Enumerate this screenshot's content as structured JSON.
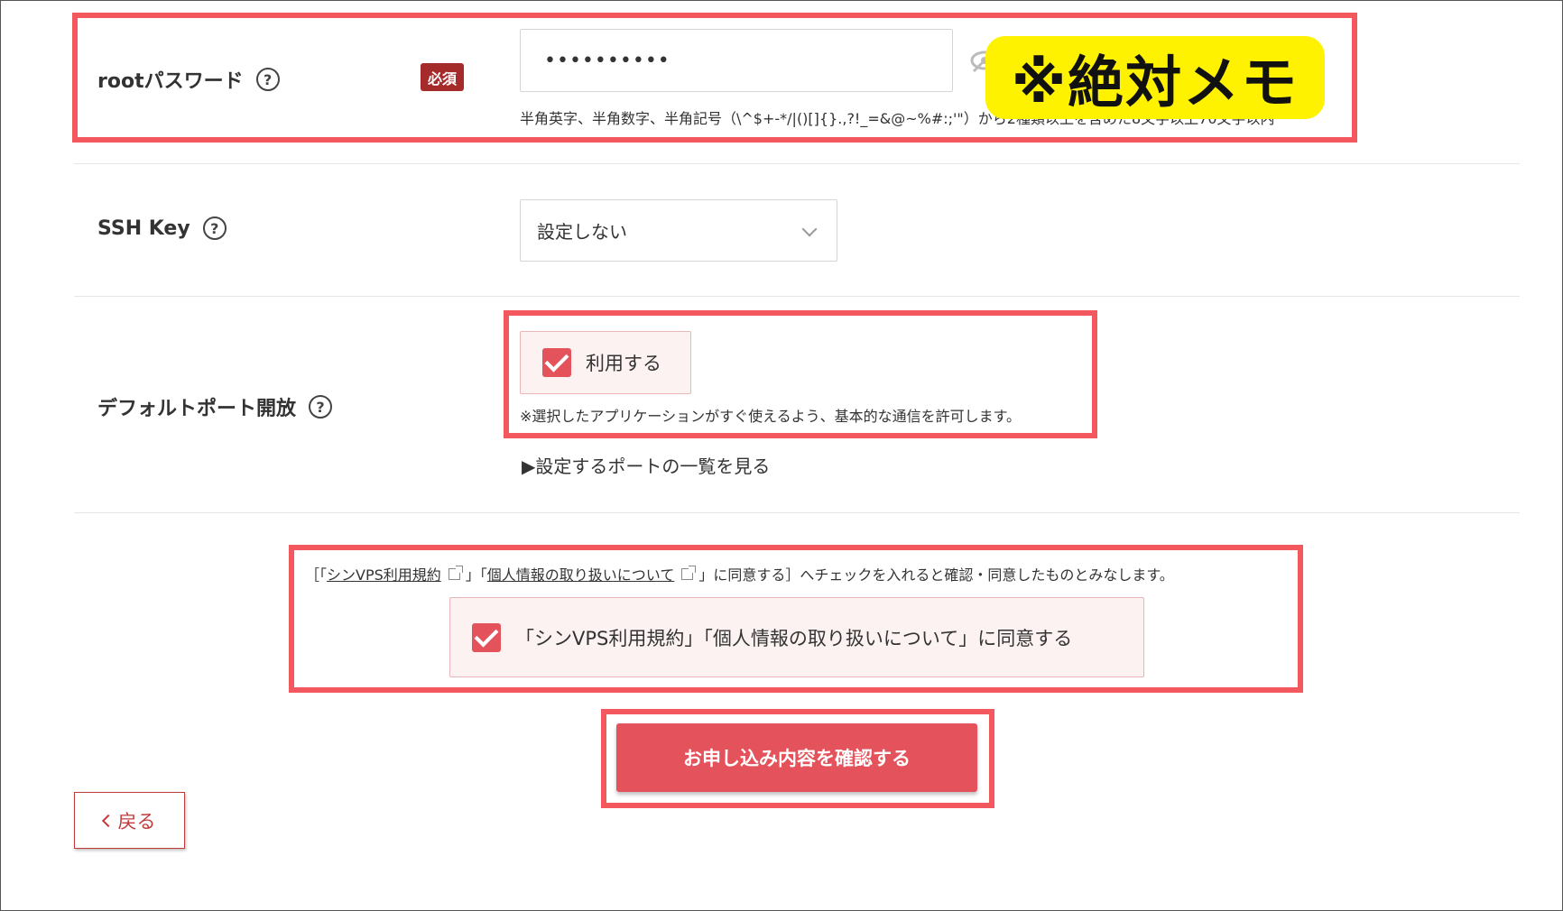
{
  "root_password": {
    "label": "rootパスワード",
    "help": "?",
    "required_badge": "必須",
    "value": "••••••••••",
    "hint": "半角英字、半角数字、半角記号（\\^$+-*/|()[]{}.,?!_=&@~%#:;'\"）から2種類以上を含めた8文字以上70文字以内",
    "memo_callout": "※絶対メモ"
  },
  "ssh_key": {
    "label": "SSH Key",
    "help": "?",
    "selected": "設定しない"
  },
  "default_port": {
    "label": "デフォルトポート開放",
    "help": "?",
    "checkbox_label": "利用する",
    "note": "※選択したアプリケーションがすぐ使えるよう、基本的な通信を許可します。",
    "ports_link": "▶設定するポートの一覧を見る"
  },
  "agreement": {
    "prefix": "［「",
    "terms_link": "シンVPS利用規約",
    "mid": "」「",
    "privacy_link": "個人情報の取り扱いについて",
    "suffix": "」に同意する］へチェックを入れると確認・同意したものとみなします。",
    "checkbox_label": "「シンVPS利用規約」「個人情報の取り扱いについて」に同意する"
  },
  "actions": {
    "submit": "お申し込み内容を確認する",
    "back": "戻る"
  },
  "colors": {
    "accent": "#e4535b",
    "highlight": "#f4585f",
    "required": "#a52b2b",
    "memo": "#fff200"
  }
}
